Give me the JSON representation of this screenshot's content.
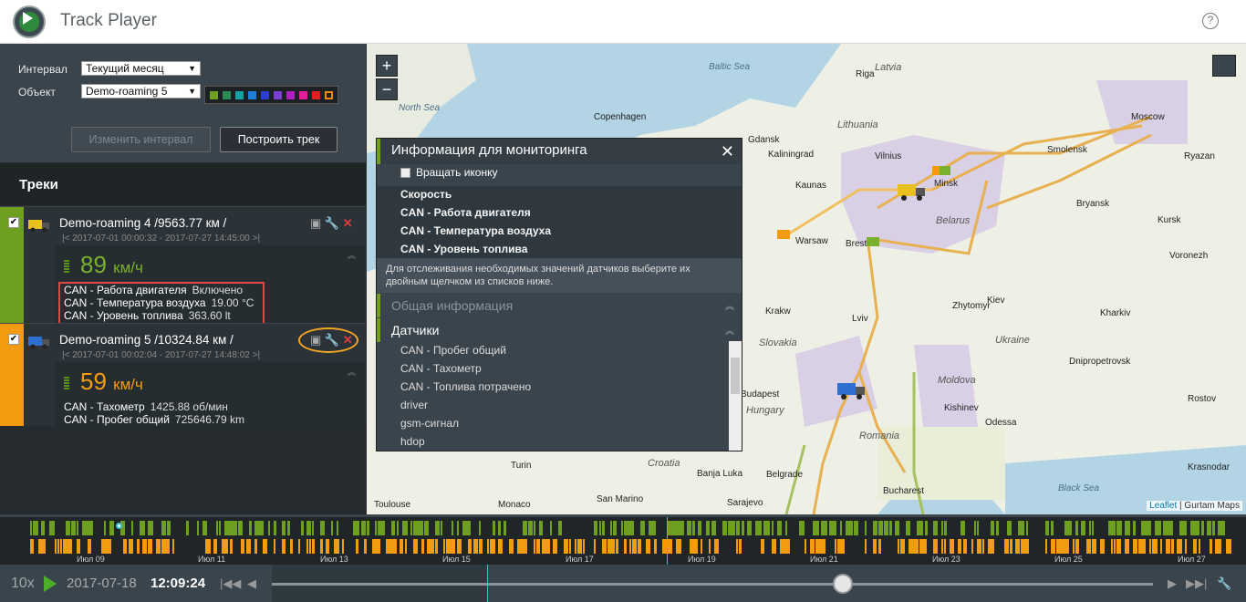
{
  "app": {
    "title": "Track Player"
  },
  "controls": {
    "interval_label": "Интервал",
    "interval_value": "Текущий месяц",
    "object_label": "Объект",
    "object_value": "Demo-roaming 5",
    "change_interval_btn": "Изменить интервал",
    "build_track_btn": "Построить трек",
    "palette": [
      "#6e9f20",
      "#2e8b57",
      "#17a2a2",
      "#1f7fd6",
      "#2b3fd1",
      "#7b3fd1",
      "#b020c0",
      "#e0209a",
      "#e02020",
      "#f08a10"
    ]
  },
  "tracks": {
    "title": "Треки",
    "items": [
      {
        "name": "Demo-roaming 4 /9563.77 км /",
        "dates": "2017-07-01 00:00:32 - 2017-07-27 14:45:00",
        "speed_value": "89",
        "speed_unit": "км/ч",
        "color": "#6e9f20",
        "sensors": [
          {
            "name": "CAN - Работа двигателя",
            "value": "Включено"
          },
          {
            "name": "CAN - Температура воздуха",
            "value": "19.00 °C"
          },
          {
            "name": "CAN - Уровень топлива",
            "value": "363.60 lt"
          }
        ]
      },
      {
        "name": "Demo-roaming 5 /10324.84 км /",
        "dates": "2017-07-01 00:02:04 - 2017-07-27 14:48:02",
        "speed_value": "59",
        "speed_unit": "км/ч",
        "color": "#f39c12",
        "sensors": [
          {
            "name": "CAN - Тахометр",
            "value": "1425.88 об/мин"
          },
          {
            "name": "CAN - Пробег общий",
            "value": "725646.79 km"
          }
        ]
      }
    ]
  },
  "monitoring": {
    "title": "Информация для мониторинга",
    "rotate_icon": "Вращать иконку",
    "selected": [
      "Скорость",
      "CAN - Работа двигателя",
      "CAN - Температура воздуха",
      "CAN - Уровень топлива"
    ],
    "hint": "Для отслеживания необходимых значений датчиков выберите их двойным щелчком из списков ниже.",
    "general_section": "Общая информация",
    "sensors_section": "Датчики",
    "sensor_list": [
      "CAN - Пробег общий",
      "CAN - Тахометр",
      "CAN - Топлива потрачено",
      "driver",
      "gsm-сигнал",
      "hdop"
    ]
  },
  "map": {
    "zoom_in": "+",
    "zoom_out": "−",
    "attribution_link": "Leaflet",
    "attribution_text": "| Gurtam Maps",
    "seas": [
      "Baltic Sea",
      "North Sea",
      "Black Sea"
    ],
    "countries": [
      "Latvia",
      "Lithuania",
      "Belarus",
      "Slovakia",
      "Ukraine",
      "Moldova",
      "Hungary",
      "Romania",
      "Croatia"
    ],
    "cities": [
      "Riga",
      "Copenhagen",
      "Kaliningrad",
      "Vilnius",
      "Minsk",
      "Smolensk",
      "Moscow",
      "Ryazan",
      "Bryansk",
      "Kursk",
      "Warsaw",
      "Brest",
      "Voronezh",
      "Kiev",
      "Zhytomyr",
      "Krakw",
      "Lviv",
      "Kharkiv",
      "Budapest",
      "Kishinev",
      "Odessa",
      "Dnipropetrovsk",
      "Rostov",
      "Belgrade",
      "Bucharest",
      "Banja Luka",
      "Sarajevo",
      "Monaco",
      "San Marino",
      "Turin",
      "Toulouse",
      "Krasnodar",
      "Gdansk",
      "Kaunas"
    ]
  },
  "timeline": {
    "ticks": [
      "Июл 09",
      "Июл 11",
      "Июл 13",
      "Июл 15",
      "Июл 17",
      "Июл 19",
      "Июл 21",
      "Июл 23",
      "Июл 25",
      "Июл 27"
    ]
  },
  "player": {
    "speed": "10x",
    "date": "2017-07-18",
    "time": "12:09:24"
  }
}
